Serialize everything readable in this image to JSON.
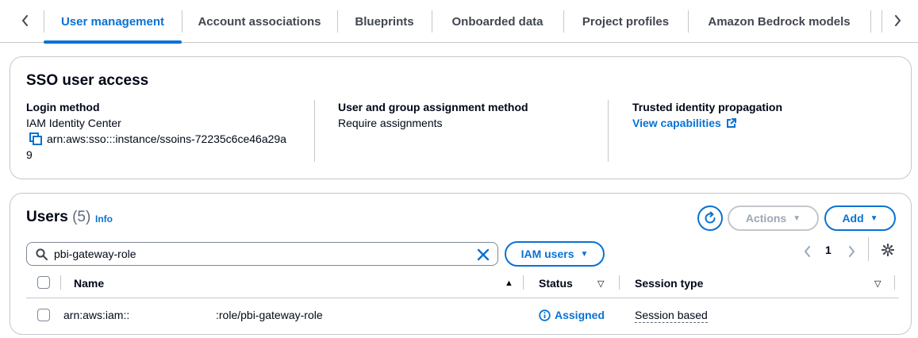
{
  "tabs": [
    {
      "label": "User management",
      "active": true
    },
    {
      "label": "Account associations",
      "active": false
    },
    {
      "label": "Blueprints",
      "active": false
    },
    {
      "label": "Onboarded data",
      "active": false
    },
    {
      "label": "Project profiles",
      "active": false
    },
    {
      "label": "Amazon Bedrock models",
      "active": false
    }
  ],
  "sso": {
    "title": "SSO user access",
    "login_method_label": "Login method",
    "login_method_value": "IAM Identity Center",
    "instance_arn_line1": "arn:aws:sso:::instance/ssoins-72235c6ce46a29a",
    "instance_arn_line2": "9",
    "assignment_label": "User and group assignment method",
    "assignment_value": "Require assignments",
    "tip_label": "Trusted identity propagation",
    "tip_link": "View capabilities"
  },
  "users": {
    "title": "Users",
    "count": "(5)",
    "info": "Info",
    "actions_label": "Actions",
    "add_label": "Add",
    "search_value": "pbi-gateway-role",
    "filter_label": "IAM users",
    "page": "1",
    "columns": {
      "name": "Name",
      "status": "Status",
      "session_type": "Session type"
    },
    "rows": [
      {
        "name_prefix": "arn:aws:iam::",
        "name_suffix": ":role/pbi-gateway-role",
        "status": "Assigned",
        "session_type": "Session based"
      }
    ]
  },
  "colors": {
    "accent": "#0972d3",
    "border": "#c6c6cd",
    "disabled": "#9ba7b6"
  },
  "icons": {
    "tab_prev": "chevron-left-icon",
    "tab_next": "chevron-right-icon",
    "copy": "copy-icon",
    "external": "external-link-icon",
    "refresh": "refresh-icon",
    "search": "search-icon",
    "clear": "close-icon",
    "settings": "gear-icon",
    "info": "info-circle-icon"
  }
}
